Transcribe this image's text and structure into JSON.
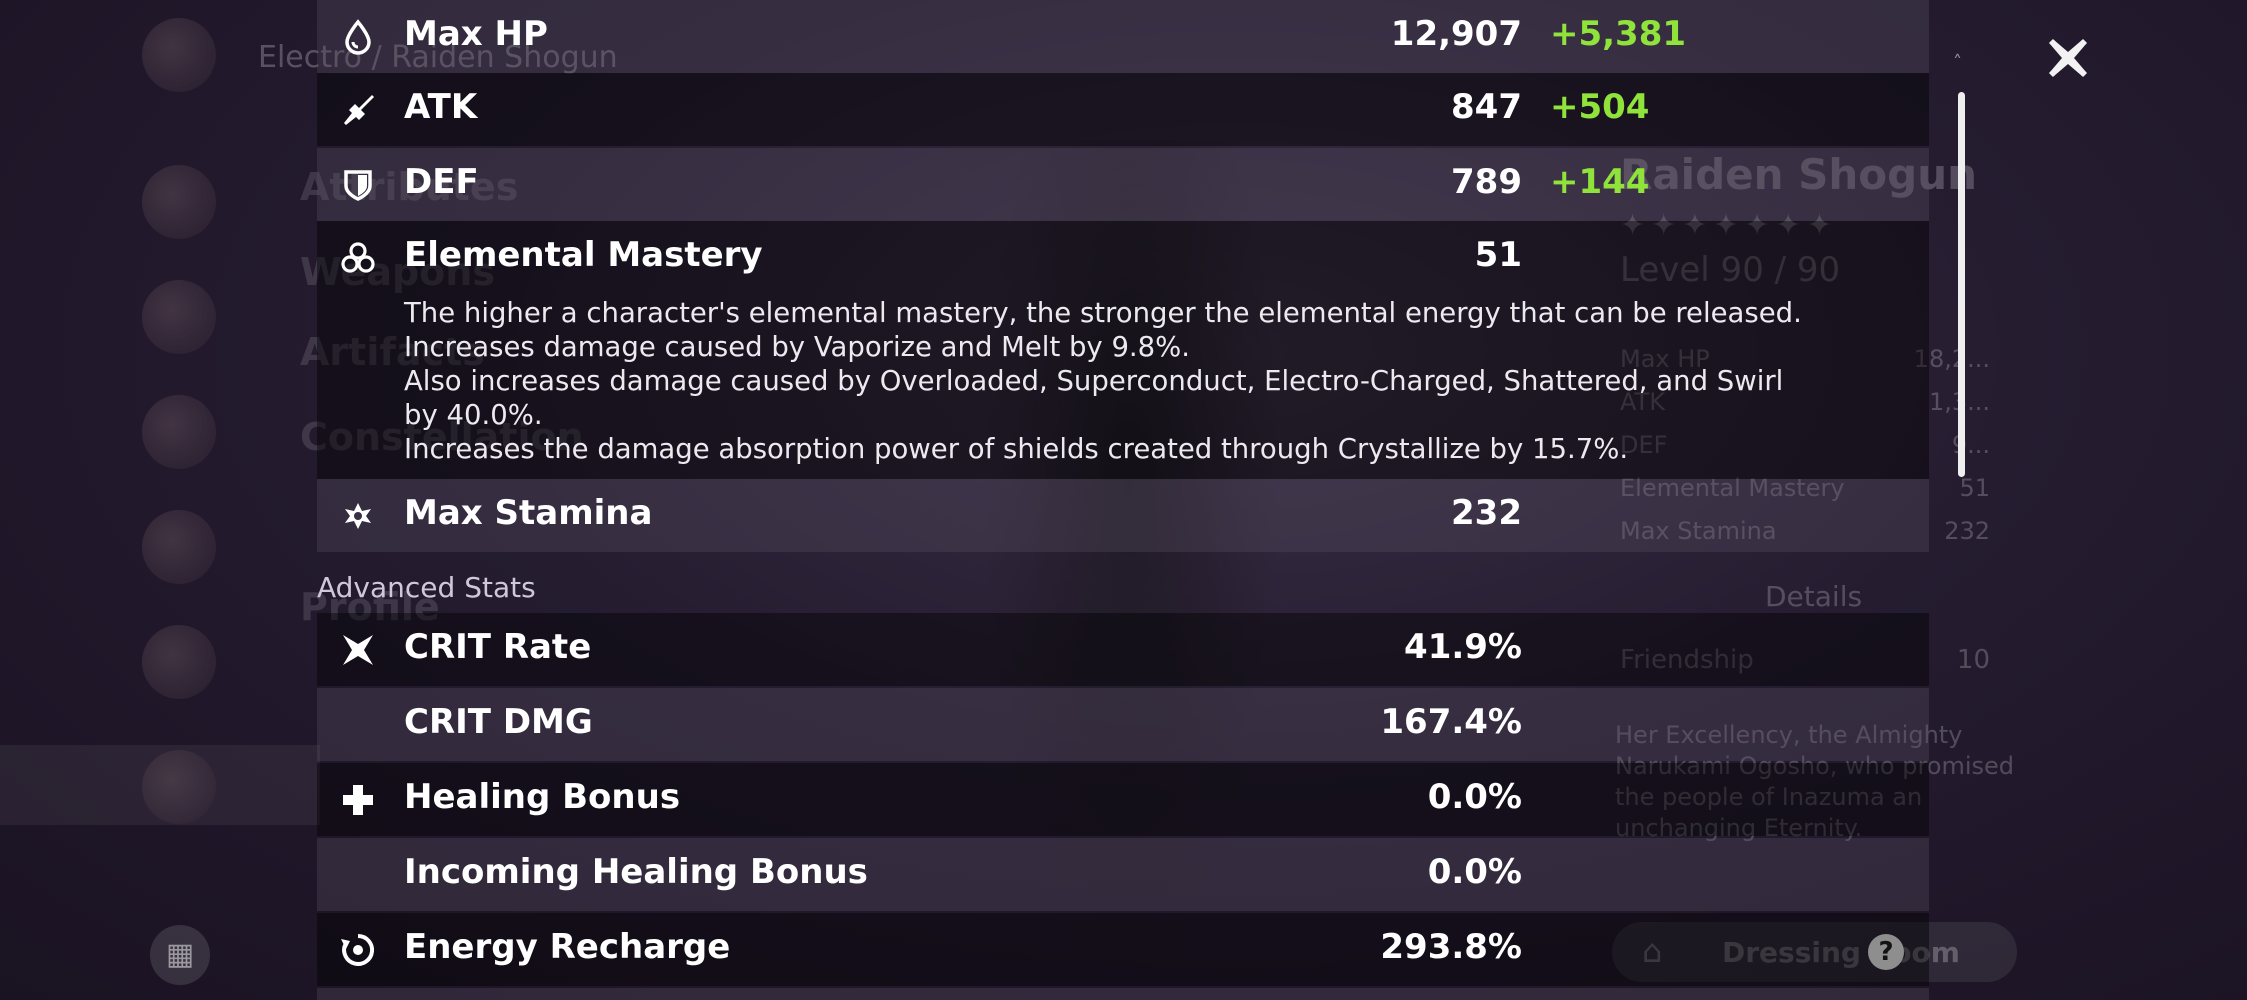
{
  "background": {
    "breadcrumb": "Electro / Raiden Shogun",
    "menu": [
      "Attributes",
      "Weapons",
      "Artifacts",
      "Constellation",
      "Profile"
    ],
    "character": {
      "name": "Raiden Shogun",
      "stars": "✦✦✦✦✦✦✦",
      "level": "Level 90 / 90",
      "mini_stats": [
        {
          "label": "Max HP",
          "value": "18,2..."
        },
        {
          "label": "ATK",
          "value": "1,3..."
        },
        {
          "label": "DEF",
          "value": "9..."
        },
        {
          "label": "Elemental Mastery",
          "value": "51"
        },
        {
          "label": "Max Stamina",
          "value": "232"
        }
      ],
      "details_label": "Details",
      "friendship_label": "Friendship",
      "friendship_value": "10",
      "description": "Her Excellency, the Almighty Narukami Ogosho, who promised the people of Inazuma an unchanging Eternity."
    },
    "dressing_room_label": "Dressing Room"
  },
  "stats": {
    "max_hp": {
      "label": "Max HP",
      "value": "12,907",
      "bonus": "+5,381"
    },
    "atk": {
      "label": "ATK",
      "value": "847",
      "bonus": "+504"
    },
    "def": {
      "label": "DEF",
      "value": "789",
      "bonus": "+144"
    },
    "elemental_mastery": {
      "label": "Elemental Mastery",
      "value": "51",
      "description": [
        "The higher a character's elemental mastery, the stronger the elemental energy that can be released.",
        "Increases damage caused by Vaporize and Melt by 9.8%.",
        "Also increases damage caused by Overloaded, Superconduct, Electro-Charged, Shattered, and Swirl",
        "by 40.0%.",
        "Increases the damage absorption power of shields created through Crystallize by 15.7%."
      ]
    },
    "max_stamina": {
      "label": "Max Stamina",
      "value": "232"
    }
  },
  "advanced_stats": {
    "title": "Advanced Stats",
    "crit_rate": {
      "label": "CRIT Rate",
      "value": "41.9%"
    },
    "crit_dmg": {
      "label": "CRIT DMG",
      "value": "167.4%"
    },
    "healing_bonus": {
      "label": "Healing Bonus",
      "value": "0.0%"
    },
    "incoming_healing_bonus": {
      "label": "Incoming Healing Bonus",
      "value": "0.0%"
    },
    "energy_recharge": {
      "label": "Energy Recharge",
      "value": "293.8%"
    }
  },
  "colors": {
    "bonus_green": "#8fe33a",
    "text_white": "#ffffff"
  },
  "icons": {
    "close": "close-icon",
    "help": "?"
  }
}
